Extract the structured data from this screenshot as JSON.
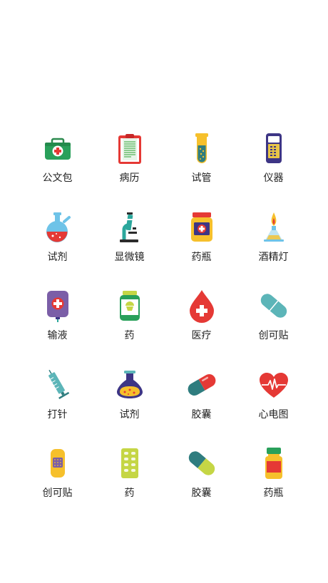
{
  "items": [
    {
      "label": "公文包",
      "icon": "first-aid-kit-icon"
    },
    {
      "label": "病历",
      "icon": "medical-record-clipboard-icon"
    },
    {
      "label": "试管",
      "icon": "test-tube-icon"
    },
    {
      "label": "仪器",
      "icon": "device-instrument-icon"
    },
    {
      "label": "试剂",
      "icon": "round-flask-icon"
    },
    {
      "label": "显微镜",
      "icon": "microscope-icon"
    },
    {
      "label": "药瓶",
      "icon": "medicine-jar-icon"
    },
    {
      "label": "酒精灯",
      "icon": "alcohol-lamp-icon"
    },
    {
      "label": "输液",
      "icon": "iv-bag-icon"
    },
    {
      "label": "药",
      "icon": "pill-bottle-icon"
    },
    {
      "label": "医疗",
      "icon": "blood-drop-cross-icon"
    },
    {
      "label": "创可贴",
      "icon": "capsule-bandage-icon"
    },
    {
      "label": "打针",
      "icon": "syringe-icon"
    },
    {
      "label": "试剂",
      "icon": "conical-flask-icon"
    },
    {
      "label": "胶囊",
      "icon": "capsule-red-icon"
    },
    {
      "label": "心电图",
      "icon": "heart-ecg-icon"
    },
    {
      "label": "创可贴",
      "icon": "adhesive-bandage-icon"
    },
    {
      "label": "药",
      "icon": "pill-blister-pack-icon"
    },
    {
      "label": "胶囊",
      "icon": "capsule-yellow-icon"
    },
    {
      "label": "药瓶",
      "icon": "medicine-bottle-icon"
    }
  ]
}
